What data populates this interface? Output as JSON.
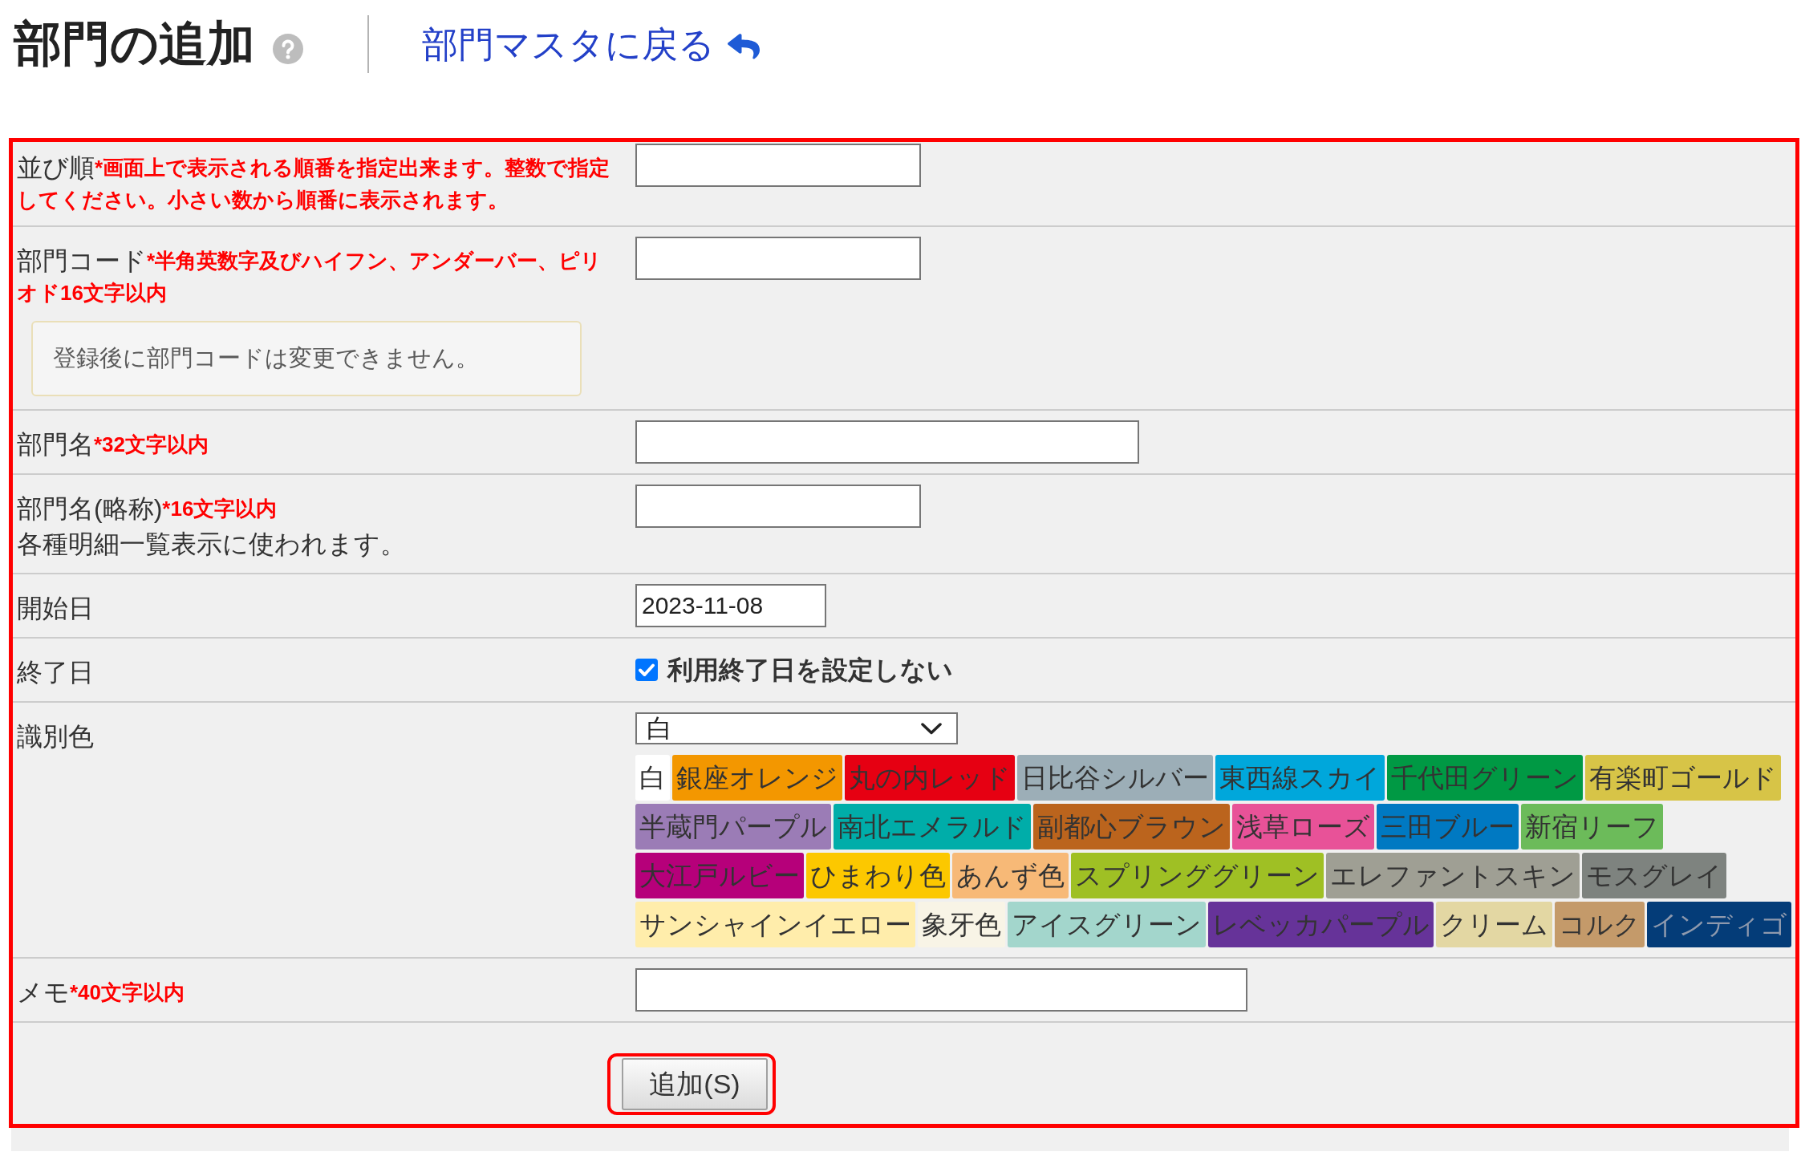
{
  "header": {
    "title": "部門の追加",
    "back_link": "部門マスタに戻る"
  },
  "form": {
    "highlighted": true,
    "rows": [
      {
        "kind": "text",
        "label": "並び順",
        "note": "*画面上で表示される順番を指定出来ます。整数で指定してください。小さい数から順番に表示されます。"
      },
      {
        "kind": "text",
        "label": "部門コード",
        "note": "*半角英数字及びハイフン、アンダーバー、ピリオド16文字以内",
        "info": "登録後に部門コードは変更できません。"
      },
      {
        "kind": "text",
        "label": "部門名",
        "note": "*32文字以内"
      },
      {
        "kind": "text",
        "label": "部門名(略称)",
        "note": "*16文字以内",
        "description": "各種明細一覧表示に使われます。"
      },
      {
        "kind": "date",
        "label": "開始日",
        "value": "2023-11-08"
      },
      {
        "kind": "checkbox",
        "label": "終了日",
        "option": {
          "label": "利用終了日を設定しない",
          "checked": true
        }
      },
      {
        "kind": "color",
        "label": "識別色",
        "select_value": "白",
        "swatches": [
          {
            "label": "白",
            "color": "#ffffff"
          },
          {
            "label": "銀座オレンジ",
            "color": "#f39700"
          },
          {
            "label": "丸の内レッド",
            "color": "#e60012"
          },
          {
            "label": "日比谷シルバー",
            "color": "#9caeb7"
          },
          {
            "label": "東西線スカイ",
            "color": "#00a7db"
          },
          {
            "label": "千代田グリーン",
            "color": "#009944"
          },
          {
            "label": "有楽町ゴールド",
            "color": "#d7c447"
          },
          {
            "label": "半蔵門パープル",
            "color": "#9b7cb6"
          },
          {
            "label": "南北エメラルド",
            "color": "#00ada9"
          },
          {
            "label": "副都心ブラウン",
            "color": "#bb641d"
          },
          {
            "label": "浅草ローズ",
            "color": "#e85298"
          },
          {
            "label": "三田ブルー",
            "color": "#0079c2"
          },
          {
            "label": "新宿リーフ",
            "color": "#6cbb5a"
          },
          {
            "label": "大江戸ルビー",
            "color": "#b6007a"
          },
          {
            "label": "ひまわり色",
            "color": "#fcc800"
          },
          {
            "label": "あんず色",
            "color": "#f7b977"
          },
          {
            "label": "スプリンググリーン",
            "color": "#9fc024"
          },
          {
            "label": "エレファントスキン",
            "color": "#9f9f94"
          },
          {
            "label": "モスグレイ",
            "color": "#7e837f"
          },
          {
            "label": "サンシャインイエロー",
            "color": "#ffedab"
          },
          {
            "label": "象牙色",
            "color": "#f8f4e6"
          },
          {
            "label": "アイスグリーン",
            "color": "#a3d6cc"
          },
          {
            "label": "レベッカパープル",
            "color": "#663399"
          },
          {
            "label": "クリーム",
            "color": "#e3d7a3"
          },
          {
            "label": "コルク",
            "color": "#c49a6a"
          },
          {
            "label": "インディゴ",
            "color": "#043c78"
          }
        ]
      },
      {
        "kind": "text",
        "label": "メモ",
        "note": "*40文字以内"
      }
    ],
    "submit_button": {
      "label": "追加(S)",
      "highlighted": true
    }
  }
}
